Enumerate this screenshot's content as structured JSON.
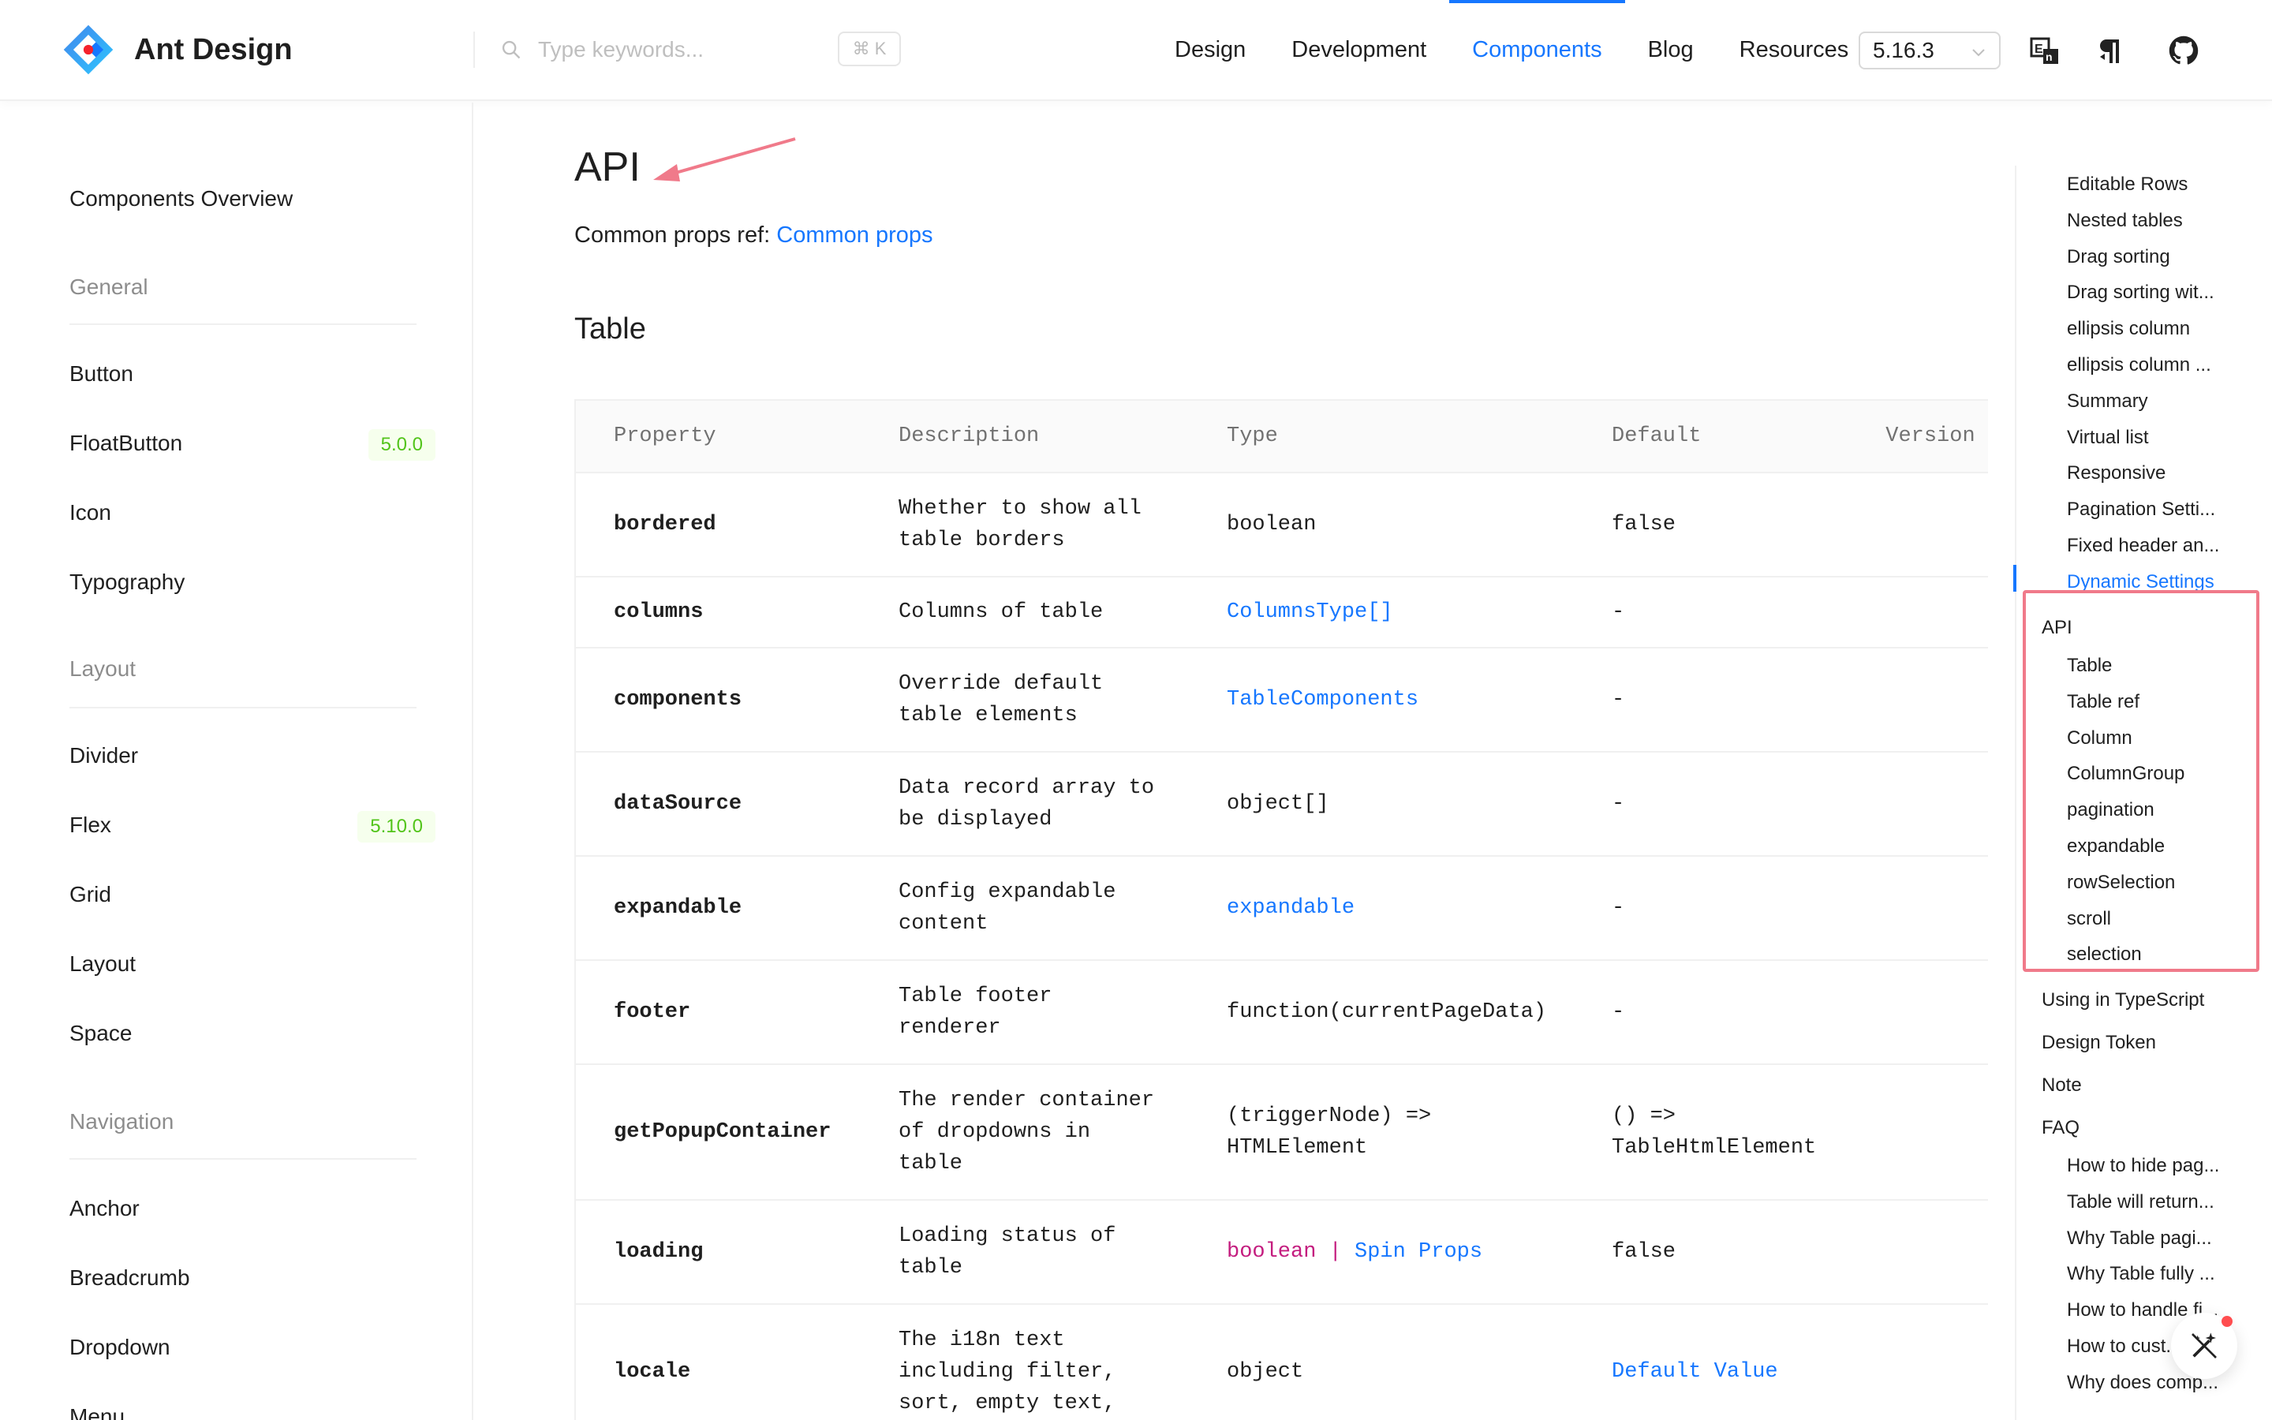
{
  "header": {
    "logo_text": "Ant Design",
    "search_placeholder": "Type keywords...",
    "search_shortcut": "⌘ K",
    "nav": [
      "Design",
      "Development",
      "Components",
      "Blog",
      "Resources"
    ],
    "active_nav": "Components",
    "version": "5.16.3",
    "icons": [
      "language-switch-icon",
      "text-direction-icon",
      "github-icon"
    ]
  },
  "sidebar": {
    "overview": "Components Overview",
    "groups": {
      "general": "General",
      "layout": "Layout",
      "navigation": "Navigation"
    },
    "general_items": [
      "Button",
      "FloatButton",
      "Icon",
      "Typography"
    ],
    "floatbutton_badge": "5.0.0",
    "layout_items": [
      "Divider",
      "Flex",
      "Grid",
      "Layout",
      "Space"
    ],
    "flex_badge": "5.10.0",
    "navigation_items": [
      "Anchor",
      "Breadcrumb",
      "Dropdown",
      "Menu"
    ]
  },
  "main": {
    "title": "API",
    "common_props_label": "Common props ref:",
    "common_props_link": "Common props",
    "section_title": "Table",
    "table": {
      "headers": [
        "Property",
        "Description",
        "Type",
        "Default",
        "Version"
      ],
      "rows": [
        {
          "property": "bordered",
          "description": [
            "Whether to show all",
            "table borders"
          ],
          "type": "boolean",
          "default": "false"
        },
        {
          "property": "columns",
          "description": [
            "Columns of table"
          ],
          "type": "ColumnsType[]",
          "default": "-"
        },
        {
          "property": "components",
          "description": [
            "Override default",
            "table elements"
          ],
          "type": "TableComponents",
          "default": "-"
        },
        {
          "property": "dataSource",
          "description": [
            "Data record array to",
            "be displayed"
          ],
          "type": "object[]",
          "default": "-"
        },
        {
          "property": "expandable",
          "description": [
            "Config expandable",
            "content"
          ],
          "type": "expandable",
          "default": "-"
        },
        {
          "property": "footer",
          "description": [
            "Table footer",
            "renderer"
          ],
          "type": "function(currentPageData)",
          "default": "-"
        },
        {
          "property": "getPopupContainer",
          "description": [
            "The render container",
            "of dropdowns in",
            "table"
          ],
          "type": "(triggerNode) => HTMLElement",
          "default": "() => TableHtmlElement"
        },
        {
          "property": "loading",
          "description": [
            "Loading status of",
            "table"
          ],
          "type": "boolean | Spin Props",
          "default": "false"
        },
        {
          "property": "locale",
          "description": [
            "The i18n text",
            "including filter,",
            "sort, empty text,"
          ],
          "type": "object",
          "default": "Default Value"
        }
      ]
    }
  },
  "anchor": {
    "items_before": [
      "Editable Rows",
      "Nested tables",
      "Drag sorting",
      "Drag sorting wit...",
      "ellipsis column",
      "ellipsis column ...",
      "Summary",
      "Virtual list",
      "Responsive",
      "Pagination Setti...",
      "Fixed header an...",
      "Dynamic Settings"
    ],
    "active": "Dynamic Settings",
    "api": "API",
    "api_children": [
      "Table",
      "Table ref",
      "Column",
      "ColumnGroup",
      "pagination",
      "expandable",
      "rowSelection",
      "scroll",
      "selection"
    ],
    "top_level_after": [
      "Using in TypeScript",
      "Design Token",
      "Note",
      "FAQ"
    ],
    "faq_children": [
      "How to hide pag...",
      "Table will return...",
      "Why Table pagi...",
      "Why Table fully ...",
      "How to handle fi...",
      "How to cust...",
      "Why does comp..."
    ]
  },
  "colors": {
    "primary": "#1677ff",
    "magenta": "#c41d7f",
    "badge_green": "#52c41a",
    "annotation_red": "#f07a8a"
  }
}
